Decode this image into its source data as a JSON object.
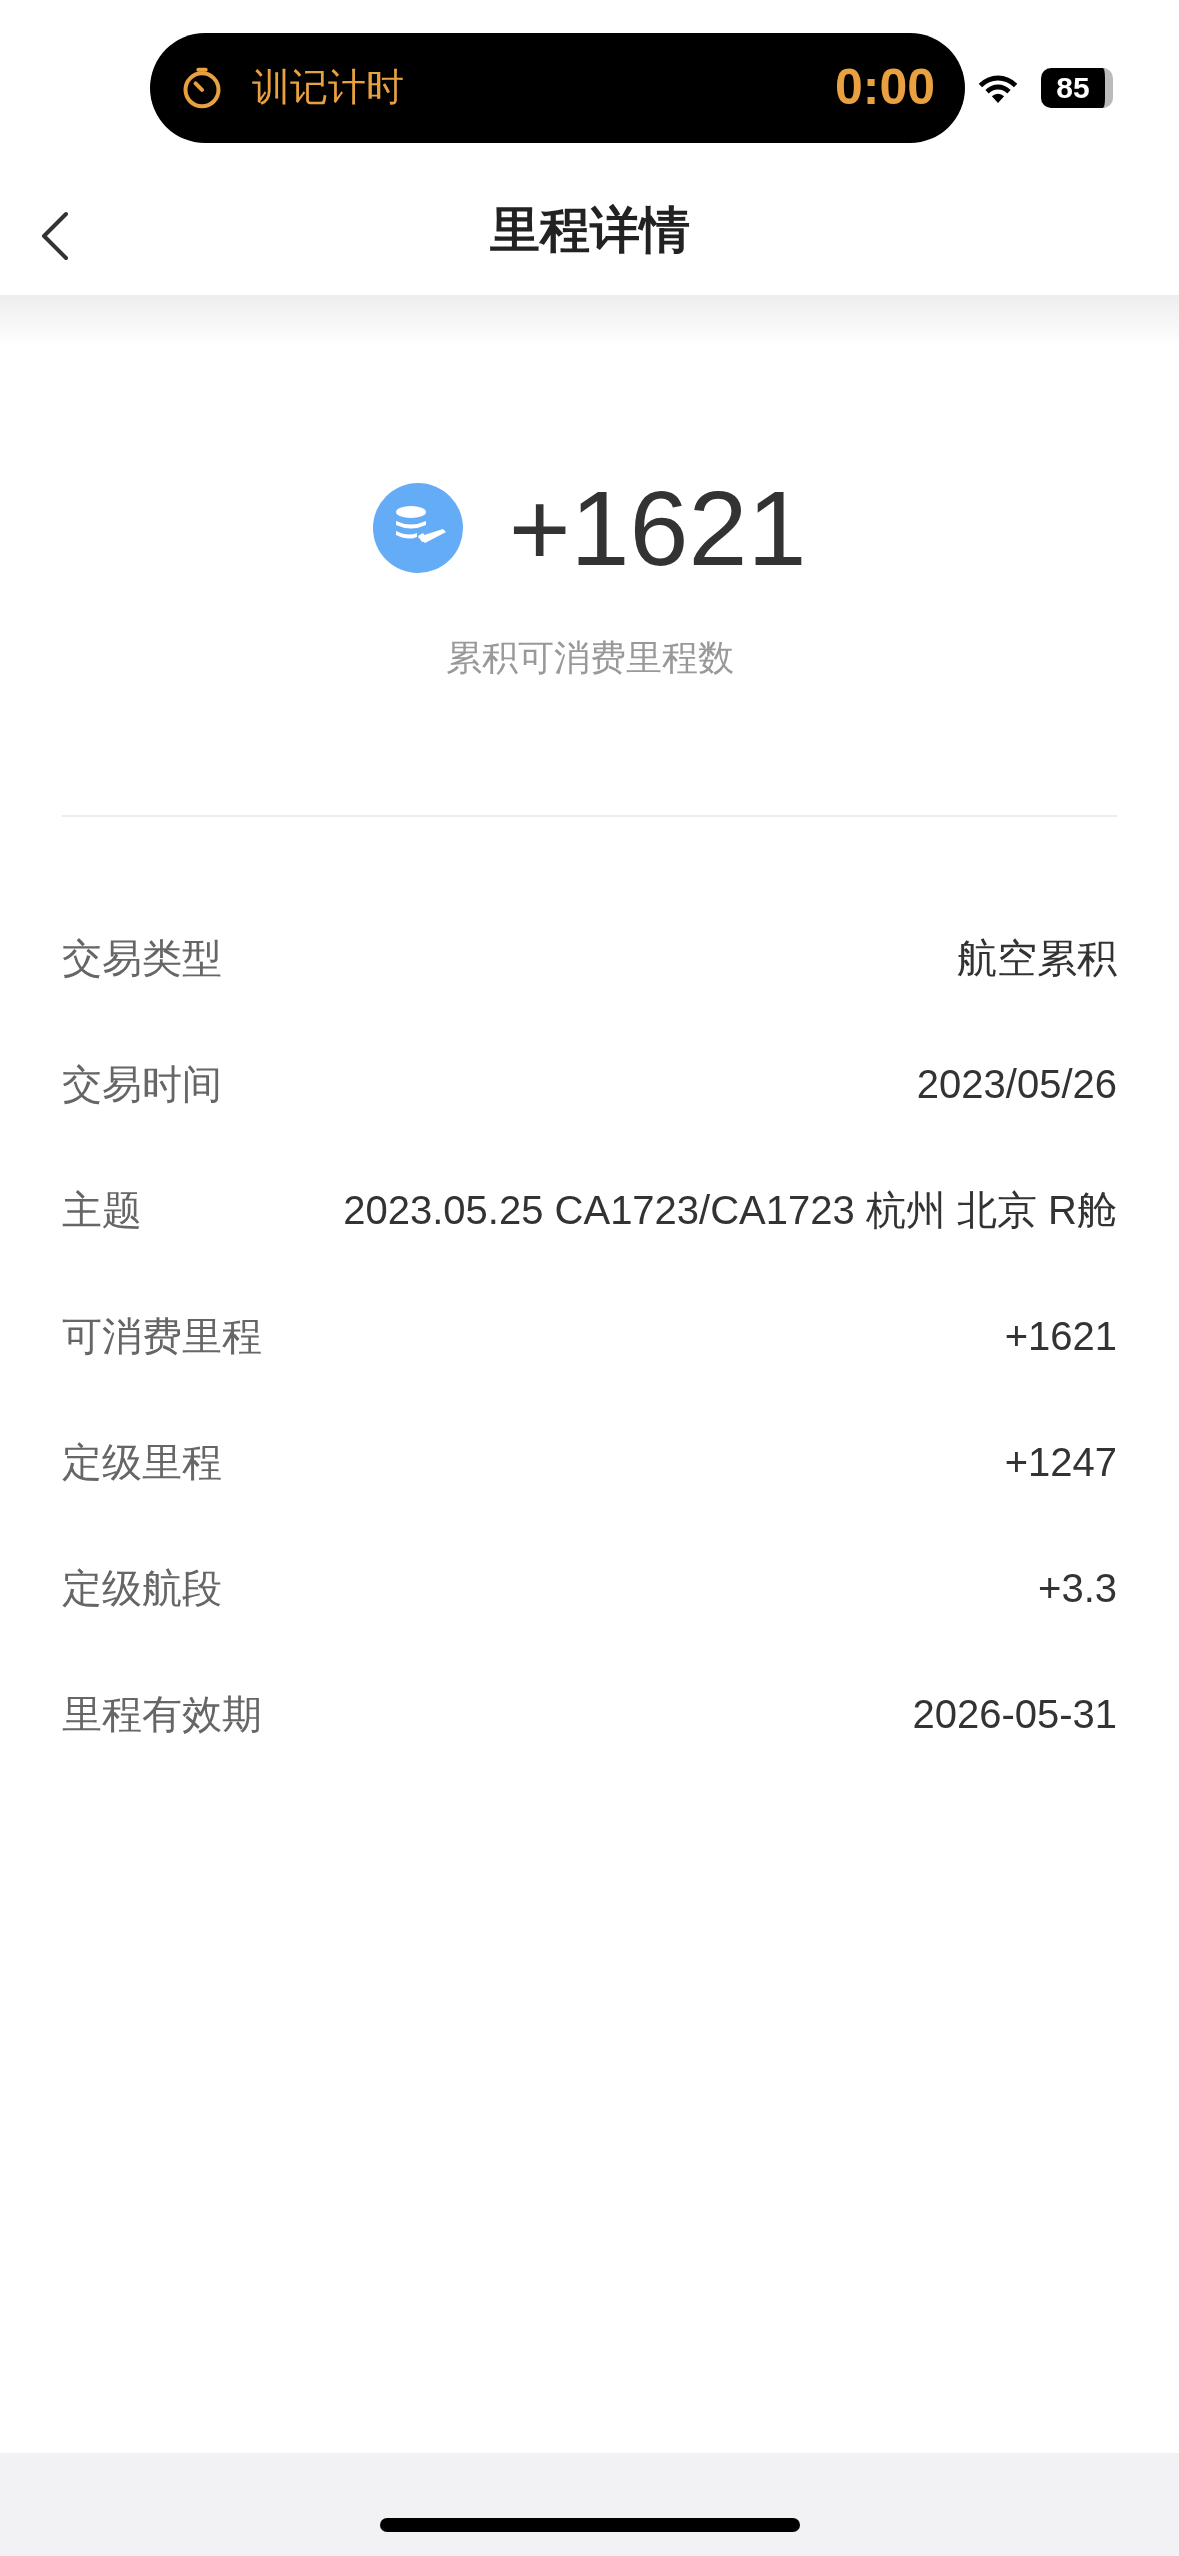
{
  "status_bar": {
    "activity": {
      "label": "训记计时",
      "timer": "0:00"
    },
    "battery": "85"
  },
  "header": {
    "title": "里程详情"
  },
  "summary": {
    "amount": "+1621",
    "caption": "累积可消费里程数"
  },
  "details": [
    {
      "label": "交易类型",
      "value": "航空累积"
    },
    {
      "label": "交易时间",
      "value": "2023/05/26"
    },
    {
      "label": "主题",
      "value": "2023.05.25 CA1723/CA1723 杭州 北京 R舱"
    },
    {
      "label": "可消费里程",
      "value": "+1621"
    },
    {
      "label": "定级里程",
      "value": "+1247"
    },
    {
      "label": "定级航段",
      "value": "+3.3"
    },
    {
      "label": "里程有效期",
      "value": "2026-05-31"
    }
  ]
}
